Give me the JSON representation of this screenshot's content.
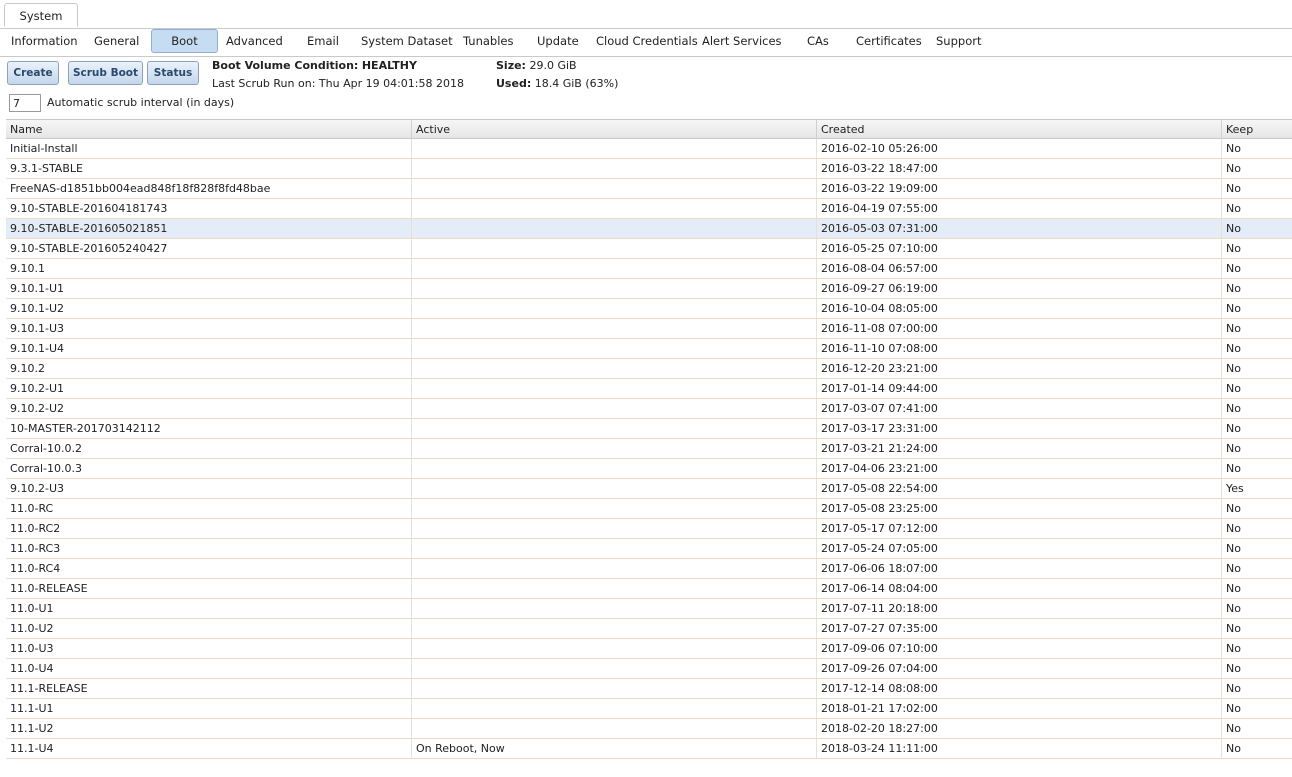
{
  "top_tab": "System",
  "sub_tabs": [
    "Information",
    "General",
    "Boot",
    "Advanced",
    "Email",
    "System Dataset",
    "Tunables",
    "Update",
    "Cloud Credentials",
    "Alert Services",
    "CAs",
    "Certificates",
    "Support"
  ],
  "active_sub_tab": "Boot",
  "buttons": {
    "create": "Create",
    "scrub_boot": "Scrub Boot",
    "status": "Status"
  },
  "boot_info": {
    "condition_label": "Boot Volume Condition:",
    "condition_value": "HEALTHY",
    "last_scrub": "Last Scrub Run on: Thu Apr 19 04:01:58 2018",
    "size_label": "Size:",
    "size_value": "29.0 GiB",
    "used_label": "Used:",
    "used_value": "18.4 GiB (63%)"
  },
  "scrub": {
    "value": "7",
    "label": "Automatic scrub interval (in days)"
  },
  "columns": [
    "Name",
    "Active",
    "Created",
    "Keep"
  ],
  "rows": [
    {
      "name": "Initial-Install",
      "active": "",
      "created": "2016-02-10 05:26:00",
      "keep": "No"
    },
    {
      "name": "9.3.1-STABLE",
      "active": "",
      "created": "2016-03-22 18:47:00",
      "keep": "No"
    },
    {
      "name": "FreeNAS-d1851bb004ead848f18f828f8fd48bae",
      "active": "",
      "created": "2016-03-22 19:09:00",
      "keep": "No"
    },
    {
      "name": "9.10-STABLE-201604181743",
      "active": "",
      "created": "2016-04-19 07:55:00",
      "keep": "No"
    },
    {
      "name": "9.10-STABLE-201605021851",
      "active": "",
      "created": "2016-05-03 07:31:00",
      "keep": "No",
      "selected": true
    },
    {
      "name": "9.10-STABLE-201605240427",
      "active": "",
      "created": "2016-05-25 07:10:00",
      "keep": "No"
    },
    {
      "name": "9.10.1",
      "active": "",
      "created": "2016-08-04 06:57:00",
      "keep": "No"
    },
    {
      "name": "9.10.1-U1",
      "active": "",
      "created": "2016-09-27 06:19:00",
      "keep": "No"
    },
    {
      "name": "9.10.1-U2",
      "active": "",
      "created": "2016-10-04 08:05:00",
      "keep": "No"
    },
    {
      "name": "9.10.1-U3",
      "active": "",
      "created": "2016-11-08 07:00:00",
      "keep": "No"
    },
    {
      "name": "9.10.1-U4",
      "active": "",
      "created": "2016-11-10 07:08:00",
      "keep": "No"
    },
    {
      "name": "9.10.2",
      "active": "",
      "created": "2016-12-20 23:21:00",
      "keep": "No"
    },
    {
      "name": "9.10.2-U1",
      "active": "",
      "created": "2017-01-14 09:44:00",
      "keep": "No"
    },
    {
      "name": "9.10.2-U2",
      "active": "",
      "created": "2017-03-07 07:41:00",
      "keep": "No"
    },
    {
      "name": "10-MASTER-201703142112",
      "active": "",
      "created": "2017-03-17 23:31:00",
      "keep": "No"
    },
    {
      "name": "Corral-10.0.2",
      "active": "",
      "created": "2017-03-21 21:24:00",
      "keep": "No"
    },
    {
      "name": "Corral-10.0.3",
      "active": "",
      "created": "2017-04-06 23:21:00",
      "keep": "No"
    },
    {
      "name": "9.10.2-U3",
      "active": "",
      "created": "2017-05-08 22:54:00",
      "keep": "Yes"
    },
    {
      "name": "11.0-RC",
      "active": "",
      "created": "2017-05-08 23:25:00",
      "keep": "No"
    },
    {
      "name": "11.0-RC2",
      "active": "",
      "created": "2017-05-17 07:12:00",
      "keep": "No"
    },
    {
      "name": "11.0-RC3",
      "active": "",
      "created": "2017-05-24 07:05:00",
      "keep": "No"
    },
    {
      "name": "11.0-RC4",
      "active": "",
      "created": "2017-06-06 18:07:00",
      "keep": "No"
    },
    {
      "name": "11.0-RELEASE",
      "active": "",
      "created": "2017-06-14 08:04:00",
      "keep": "No"
    },
    {
      "name": "11.0-U1",
      "active": "",
      "created": "2017-07-11 20:18:00",
      "keep": "No"
    },
    {
      "name": "11.0-U2",
      "active": "",
      "created": "2017-07-27 07:35:00",
      "keep": "No"
    },
    {
      "name": "11.0-U3",
      "active": "",
      "created": "2017-09-06 07:10:00",
      "keep": "No"
    },
    {
      "name": "11.0-U4",
      "active": "",
      "created": "2017-09-26 07:04:00",
      "keep": "No"
    },
    {
      "name": "11.1-RELEASE",
      "active": "",
      "created": "2017-12-14 08:08:00",
      "keep": "No"
    },
    {
      "name": "11.1-U1",
      "active": "",
      "created": "2018-01-21 17:02:00",
      "keep": "No"
    },
    {
      "name": "11.1-U2",
      "active": "",
      "created": "2018-02-20 18:27:00",
      "keep": "No"
    },
    {
      "name": "11.1-U4",
      "active": "On Reboot, Now",
      "created": "2018-03-24 11:11:00",
      "keep": "No"
    }
  ]
}
